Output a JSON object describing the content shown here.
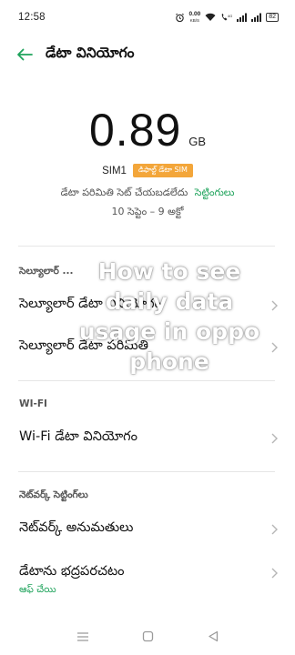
{
  "status_bar": {
    "time": "12:58",
    "net_speed_value": "0.00",
    "net_speed_unit": "KB/S",
    "battery": "82"
  },
  "header": {
    "title": "డేటా వినియోగం"
  },
  "usage": {
    "value": "0.89",
    "unit": "GB",
    "sim_label": "SIM1",
    "sim_badge": "డిఫాల్ట్ డేటా SIM",
    "limit_text": "డేటా పరిమితి సెట్ చేయబడలేదు",
    "limit_link": "సెట్టింగులు",
    "period": "10 సెప్టెం – 9 అక్టో"
  },
  "cellular": {
    "section_label": "సెల్యూలార్ ...",
    "row1": "సెల్యూలార్ డేటా వినియోగం",
    "row2": "సెల్యూలార్ డేటా పరిమితి"
  },
  "wifi": {
    "section_label": "WI-FI",
    "row1": "Wi-Fi డేటా వినియోగం"
  },
  "network": {
    "section_label": "నెట్‌వర్క్ సెట్టింగ్‌లు",
    "row1": "నెట్‌వర్క్ అనుమతులు",
    "row2": "డేటాను భద్రపరచటం",
    "row2_sub": "ఆఫ్ చేయి"
  },
  "watermark": {
    "line1": "How to see",
    "line2": "daily data",
    "line3": "usage in oppo",
    "line4": "phone"
  },
  "colors": {
    "accent": "#1ea35b",
    "badge": "#f3a63a"
  }
}
